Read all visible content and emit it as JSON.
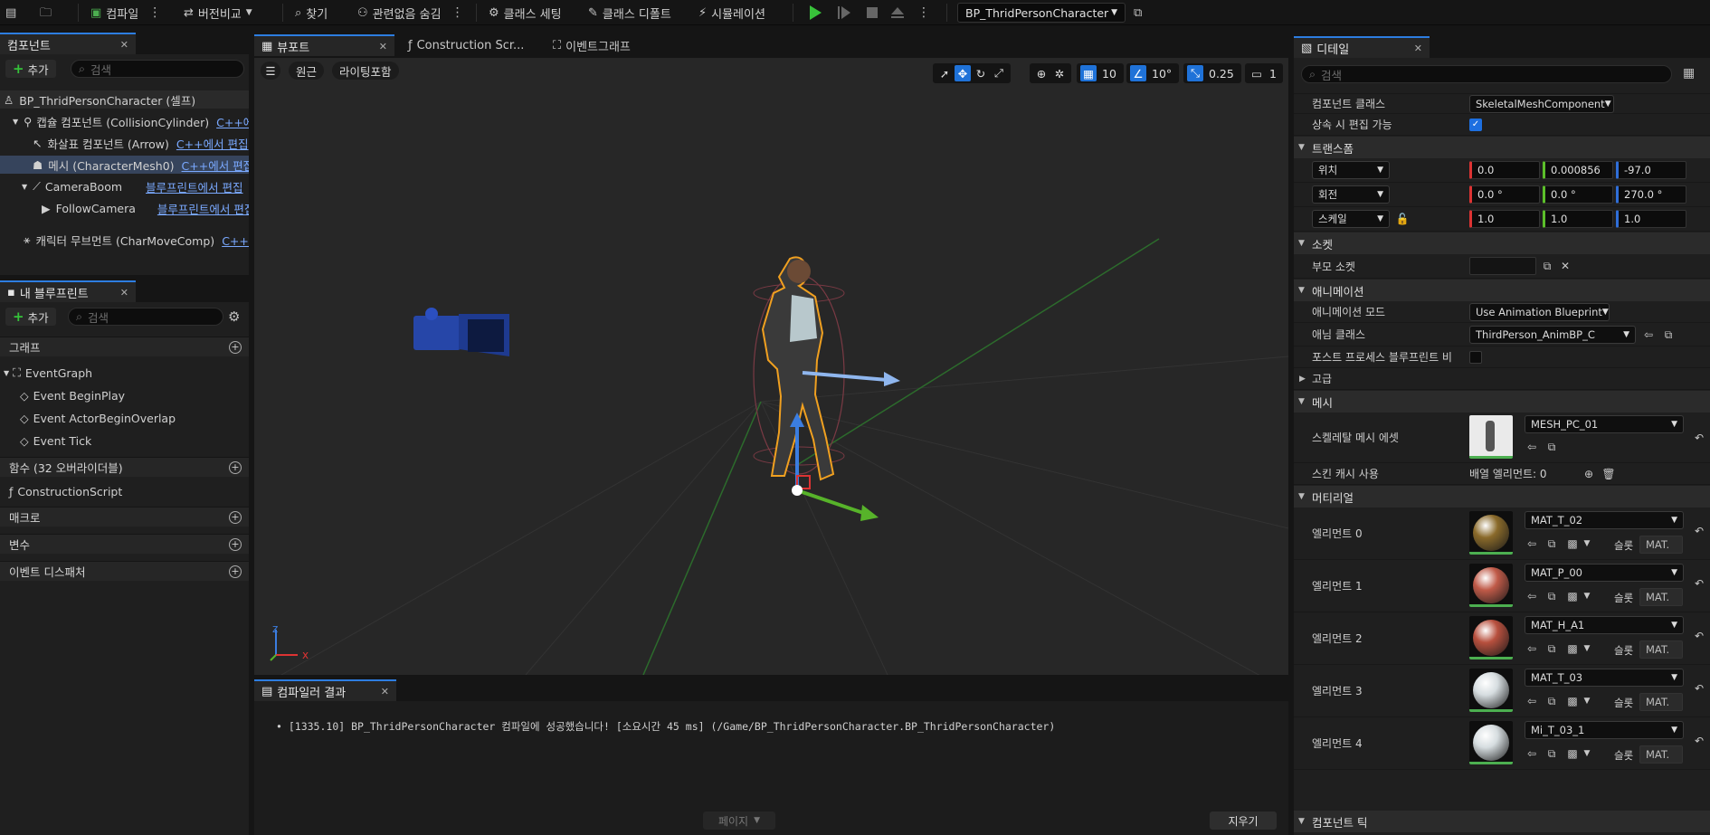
{
  "toolbar": {
    "compile": "컴파일",
    "diff": "버전비교",
    "find": "찾기",
    "hide_unrelated": "관련없음 숨김",
    "class_settings": "클래스 세팅",
    "class_defaults": "클래스 디폴트",
    "simulation": "시뮬레이션",
    "blueprint_name": "BP_ThridPersonCharacter"
  },
  "components": {
    "tab": "컴포넌트",
    "add": "추가",
    "search_placeholder": "검색",
    "root": "BP_ThridPersonCharacter (셀프)",
    "items": [
      {
        "label": "캡슐 컴포넌트 (CollisionCylinder)",
        "link": "C++에서 편집"
      },
      {
        "label": "화살표 컴포넌트 (Arrow)",
        "link": "C++에서 편집"
      },
      {
        "label": "메시 (CharacterMesh0)",
        "link": "C++에서 편집"
      },
      {
        "label": "CameraBoom",
        "link": "블루프린트에서 편집"
      },
      {
        "label": "FollowCamera",
        "link": "블루프린트에서 편집"
      },
      {
        "label": "캐릭터 무브먼트 (CharMoveComp)",
        "link": "C++에서 편집"
      }
    ]
  },
  "my_blueprint": {
    "tab": "내 블루프린트",
    "add": "추가",
    "search_placeholder": "검색",
    "graph_section": "그래프",
    "event_graph": "EventGraph",
    "events": [
      "Event BeginPlay",
      "Event ActorBeginOverlap",
      "Event Tick"
    ],
    "functions_section": "함수 (32 오버라이더블)",
    "construction_script": "ConstructionScript",
    "macros_section": "매크로",
    "variables_section": "변수",
    "dispatchers_section": "이벤트 디스패처"
  },
  "editor_tabs": {
    "viewport": "뷰포트",
    "construction": "Construction Scr...",
    "event_graph": "이벤트그래프"
  },
  "viewport": {
    "perspective": "원근",
    "lighting": "라이팅포함",
    "grid_snap": "10",
    "rotation_snap": "10°",
    "scale_snap": "0.25",
    "camera_speed": "1",
    "axis_x": "x",
    "axis_z": "z"
  },
  "compiler": {
    "tab": "컴파일러 결과",
    "message": "[1335.10] BP_ThridPersonCharacter 컴파일에 성공했습니다! [소요시간 45 ms] (/Game/BP_ThridPersonCharacter.BP_ThridPersonCharacter)",
    "page": "페이지",
    "clear": "지우기"
  },
  "details": {
    "tab": "디테일",
    "search_placeholder": "검색",
    "component_class_label": "컴포넌트 클래스",
    "component_class": "SkeletalMeshComponent",
    "editable_when_inherited": "상속 시 편집 가능",
    "transform_section": "트랜스폼",
    "location_label": "위치",
    "location": [
      "0.0",
      "0.000856",
      "-97.0"
    ],
    "rotation_label": "회전",
    "rotation": [
      "0.0 °",
      "0.0 °",
      "270.0 °"
    ],
    "scale_label": "스케일",
    "scale": [
      "1.0",
      "1.0",
      "1.0"
    ],
    "sockets_section": "소켓",
    "parent_socket": "부모 소켓",
    "animation_section": "애니메이션",
    "anim_mode_label": "애니메이션 모드",
    "anim_mode": "Use Animation Blueprint",
    "anim_class_label": "애님 클래스",
    "anim_class": "ThirdPerson_AnimBP_C",
    "post_process_label": "포스트 프로세스 블루프린트 비활...",
    "advanced_section": "고급",
    "mesh_section": "메시",
    "skeletal_mesh_label": "스켈레탈 메시 에셋",
    "skeletal_mesh": "MESH_PC_01",
    "skin_cache_label": "스킨 캐시 사용",
    "array_elements": "배열 엘리먼트: 0",
    "materials_section": "머티리얼",
    "slot_label": "슬롯",
    "slot_value": "MAT.",
    "materials": [
      {
        "label": "엘리먼트 0",
        "value": "MAT_T_02",
        "color": "#8a6a2a"
      },
      {
        "label": "엘리먼트 1",
        "value": "MAT_P_00",
        "color": "#c05a48"
      },
      {
        "label": "엘리먼트 2",
        "value": "MAT_H_A1",
        "color": "#b8503e"
      },
      {
        "label": "엘리먼트 3",
        "value": "MAT_T_03",
        "color": "#d6dde0"
      },
      {
        "label": "엘리먼트 4",
        "value": "Mi_T_03_1",
        "color": "#d6dde0"
      }
    ],
    "component_tick_section": "컴포넌트 틱"
  }
}
